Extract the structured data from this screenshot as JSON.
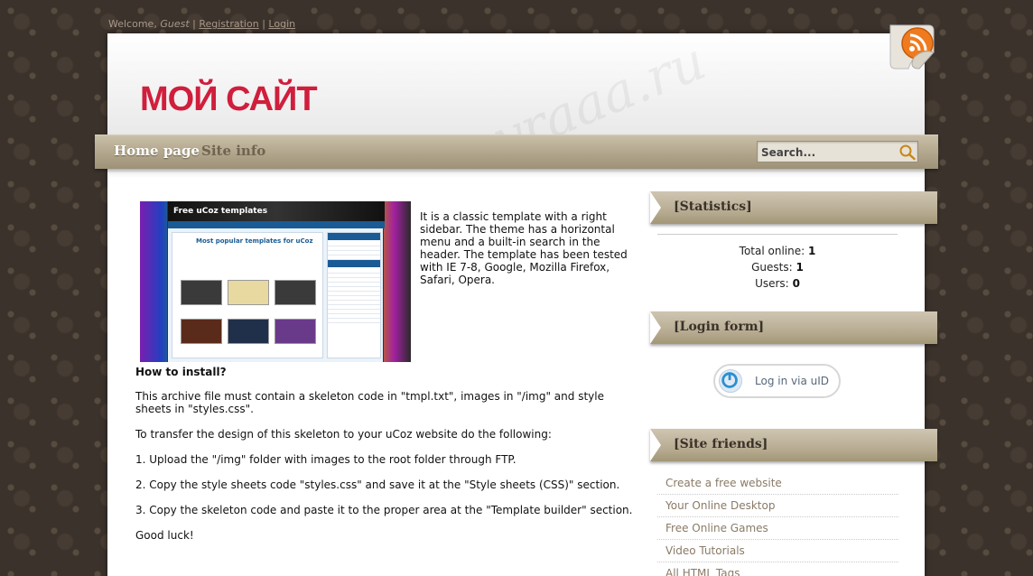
{
  "topbar": {
    "welcome": "Welcome,",
    "user": "Guest",
    "separator": "|",
    "registration": "Registration",
    "login": "Login"
  },
  "header": {
    "site_title": "МОЙ САЙТ",
    "watermark": "yraaa.ru",
    "rss_icon": "rss-feed-icon"
  },
  "nav": {
    "items": [
      {
        "label": "Home page",
        "active": true
      },
      {
        "label": "Site info",
        "active": false
      }
    ],
    "search_placeholder": "Search...",
    "search_icon": "magnifier-icon"
  },
  "thumbnail": {
    "title": "Free uCoz templates",
    "heading": "Most popular templates for uCoz"
  },
  "content": {
    "intro": "It is a classic template with a right sidebar. The theme has a horizontal menu and a built-in search in the header. The template has been tested with IE 7-8, Google, Mozilla Firefox, Safari, Opera.",
    "install_heading": "How to install?",
    "paragraphs": [
      "This archive file must contain a skeleton code in \"tmpl.txt\", images in \"/img\" and style sheets in \"styles.css\".",
      "To transfer the design of this skeleton to your uCoz website do the following:",
      "1. Upload the \"/img\" folder with images to the root folder through FTP.",
      "2. Copy the style sheets code \"styles.css\" and save it at the \"Style sheets (CSS)\" section.",
      "3. Copy the skeleton code and paste it to the proper area at the \"Template builder\" section.",
      "Good luck!"
    ]
  },
  "sidebar": {
    "statistics": {
      "title": "[Statistics]",
      "total_label": "Total online:",
      "total_value": "1",
      "guests_label": "Guests:",
      "guests_value": "1",
      "users_label": "Users:",
      "users_value": "0"
    },
    "login_form": {
      "title": "[Login form]",
      "button_label": "Log in via uID",
      "icon": "uid-logo-icon"
    },
    "site_friends": {
      "title": "[Site friends]",
      "links": [
        "Create a free website",
        "Your Online Desktop",
        "Free Online Games",
        "Video Tutorials",
        "All HTML Tags"
      ]
    }
  },
  "colors": {
    "accent_title": "#d01e3c",
    "bar": "#b3a78d",
    "background": "#3b322b"
  }
}
